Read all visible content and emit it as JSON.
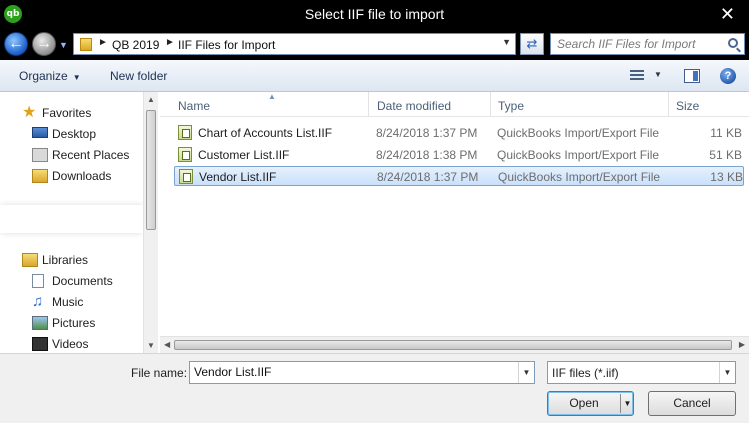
{
  "window": {
    "title": "Select IIF file to import",
    "logo_text": "qb",
    "close_glyph": "✕"
  },
  "address": {
    "segments": [
      "QB 2019",
      "IIF Files for Import"
    ],
    "search_placeholder": "Search IIF Files for Import"
  },
  "toolbar": {
    "organize": "Organize",
    "new_folder": "New folder"
  },
  "sidebar": {
    "favorites_label": "Favorites",
    "favorites": [
      {
        "label": "Desktop",
        "icon": "desktop-icon"
      },
      {
        "label": "Recent Places",
        "icon": "recent-places-icon"
      },
      {
        "label": "Downloads",
        "icon": "downloads-folder-icon"
      }
    ],
    "libraries_label": "Libraries",
    "libraries": [
      {
        "label": "Documents",
        "icon": "documents-icon"
      },
      {
        "label": "Music",
        "icon": "music-icon"
      },
      {
        "label": "Pictures",
        "icon": "pictures-icon"
      },
      {
        "label": "Videos",
        "icon": "videos-icon"
      }
    ]
  },
  "columns": {
    "name": "Name",
    "date": "Date modified",
    "type": "Type",
    "size": "Size"
  },
  "files": [
    {
      "name": "Chart of Accounts List.IIF",
      "date": "8/24/2018 1:37 PM",
      "type": "QuickBooks Import/Export File",
      "size": "11 KB",
      "selected": false
    },
    {
      "name": "Customer List.IIF",
      "date": "8/24/2018 1:38 PM",
      "type": "QuickBooks Import/Export File",
      "size": "51 KB",
      "selected": false
    },
    {
      "name": "Vendor List.IIF",
      "date": "8/24/2018 1:37 PM",
      "type": "QuickBooks Import/Export File",
      "size": "13 KB",
      "selected": true
    }
  ],
  "footer": {
    "file_name_label": "File name:",
    "file_name_value": "Vendor List.IIF",
    "file_type": "IIF files (*.iif)",
    "open_label": "Open",
    "cancel_label": "Cancel"
  },
  "colors": {
    "accent": "#2ca01c",
    "selection": "#c9e0fb",
    "titlebar": "#000000"
  }
}
